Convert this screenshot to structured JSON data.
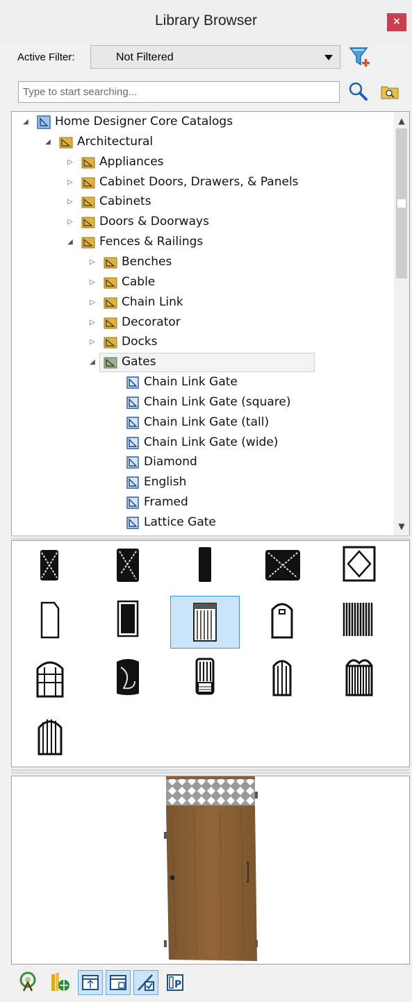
{
  "window": {
    "title": "Library Browser",
    "close_label": "×"
  },
  "filter": {
    "label": "Active Filter:",
    "value": "Not Filtered"
  },
  "search": {
    "placeholder": "Type to start searching..."
  },
  "tree": [
    {
      "label": "Home Designer Core Catalogs",
      "level": 0,
      "expander": "open",
      "icon": "catalog-icon"
    },
    {
      "label": "Architectural",
      "level": 1,
      "expander": "open",
      "icon": "folder-icon"
    },
    {
      "label": "Appliances",
      "level": 2,
      "expander": "closed",
      "icon": "folder-icon"
    },
    {
      "label": "Cabinet Doors, Drawers, & Panels",
      "level": 2,
      "expander": "closed",
      "icon": "folder-icon"
    },
    {
      "label": "Cabinets",
      "level": 2,
      "expander": "closed",
      "icon": "folder-icon"
    },
    {
      "label": "Doors & Doorways",
      "level": 2,
      "expander": "closed",
      "icon": "folder-icon"
    },
    {
      "label": "Fences & Railings",
      "level": 2,
      "expander": "open",
      "icon": "folder-icon"
    },
    {
      "label": "Benches",
      "level": 3,
      "expander": "closed",
      "icon": "folder-icon"
    },
    {
      "label": "Cable",
      "level": 3,
      "expander": "closed",
      "icon": "folder-icon"
    },
    {
      "label": "Chain Link",
      "level": 3,
      "expander": "closed",
      "icon": "folder-icon"
    },
    {
      "label": "Decorator",
      "level": 3,
      "expander": "closed",
      "icon": "folder-icon"
    },
    {
      "label": "Docks",
      "level": 3,
      "expander": "closed",
      "icon": "folder-icon"
    },
    {
      "label": "Gates",
      "level": 3,
      "expander": "open",
      "icon": "folder-icon",
      "selected": true
    },
    {
      "label": "Chain Link Gate",
      "level": 4,
      "expander": "none",
      "icon": "item-icon"
    },
    {
      "label": "Chain Link Gate (square)",
      "level": 4,
      "expander": "none",
      "icon": "item-icon"
    },
    {
      "label": "Chain Link Gate (tall)",
      "level": 4,
      "expander": "none",
      "icon": "item-icon"
    },
    {
      "label": "Chain Link Gate (wide)",
      "level": 4,
      "expander": "none",
      "icon": "item-icon"
    },
    {
      "label": "Diamond",
      "level": 4,
      "expander": "none",
      "icon": "item-icon"
    },
    {
      "label": "English",
      "level": 4,
      "expander": "none",
      "icon": "item-icon"
    },
    {
      "label": "Framed",
      "level": 4,
      "expander": "none",
      "icon": "item-icon"
    },
    {
      "label": "Lattice Gate",
      "level": 4,
      "expander": "none",
      "icon": "item-icon"
    }
  ],
  "thumbnails": [
    {
      "icon": "chain-link-gate-thumb-icon"
    },
    {
      "icon": "chain-link-gate-square-thumb-icon"
    },
    {
      "icon": "chain-link-gate-tall-thumb-icon"
    },
    {
      "icon": "chain-link-gate-wide-thumb-icon"
    },
    {
      "icon": "diamond-gate-thumb-icon"
    },
    {
      "icon": "english-gate-thumb-icon"
    },
    {
      "icon": "framed-gate-thumb-icon"
    },
    {
      "icon": "lattice-gate-thumb-icon",
      "selected": true
    },
    {
      "icon": "arched-door-gate-thumb-icon"
    },
    {
      "icon": "picket-gate-thumb-icon"
    },
    {
      "icon": "arched-panel-gate-thumb-icon"
    },
    {
      "icon": "scroll-gate-thumb-icon"
    },
    {
      "icon": "spindle-gate-thumb-icon"
    },
    {
      "icon": "round-top-gate-thumb-icon"
    },
    {
      "icon": "ornate-gate-thumb-icon"
    },
    {
      "icon": "arched-picket-gate-thumb-icon"
    }
  ],
  "toolbar": [
    {
      "icon": "tree-view-icon",
      "active": false
    },
    {
      "icon": "library-globe-icon",
      "active": false
    },
    {
      "icon": "view-top-icon",
      "active": true
    },
    {
      "icon": "view-bottom-icon",
      "active": true
    },
    {
      "icon": "edit-check-icon",
      "active": true
    },
    {
      "icon": "properties-icon",
      "active": false
    }
  ],
  "colors": {
    "selection_fill": "#cce4f7",
    "selection_border": "#3d8ee0",
    "folder": "#e2b23a",
    "catalog": "#3a6db5",
    "close": "#c84050"
  }
}
